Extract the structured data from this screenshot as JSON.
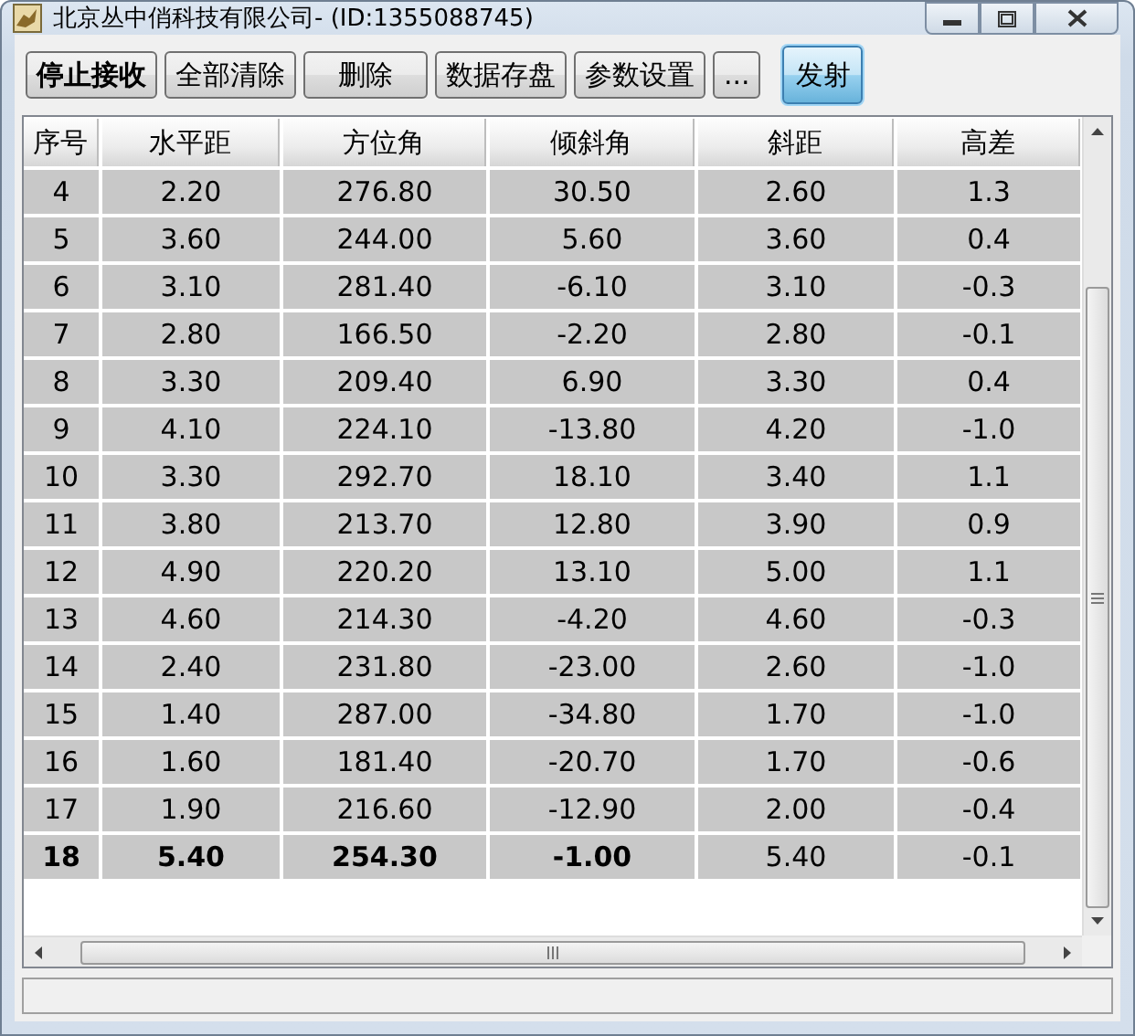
{
  "window": {
    "title": "北京丛中俏科技有限公司- (ID:1355088745)"
  },
  "toolbar": [
    {
      "label": "停止接收",
      "bold": true,
      "selected": false
    },
    {
      "label": "全部清除",
      "bold": false,
      "selected": false
    },
    {
      "label": "删除",
      "bold": false,
      "selected": false
    },
    {
      "label": "数据存盘",
      "bold": false,
      "selected": false
    },
    {
      "label": "参数设置",
      "bold": false,
      "selected": false
    },
    {
      "label": "...",
      "bold": false,
      "selected": false
    },
    {
      "label": "发射",
      "bold": false,
      "selected": true
    }
  ],
  "table": {
    "columns": [
      "序号",
      "水平距",
      "方位角",
      "倾斜角",
      "斜距",
      "高差"
    ],
    "rows": [
      {
        "cells": [
          {
            "text": "4",
            "bold": false
          },
          {
            "text": "2.20",
            "bold": false
          },
          {
            "text": "276.80",
            "bold": false
          },
          {
            "text": "30.50",
            "bold": false
          },
          {
            "text": "2.60",
            "bold": false
          },
          {
            "text": "1.3",
            "bold": false
          }
        ]
      },
      {
        "cells": [
          {
            "text": "5",
            "bold": false
          },
          {
            "text": "3.60",
            "bold": false
          },
          {
            "text": "244.00",
            "bold": false
          },
          {
            "text": "5.60",
            "bold": false
          },
          {
            "text": "3.60",
            "bold": false
          },
          {
            "text": "0.4",
            "bold": false
          }
        ]
      },
      {
        "cells": [
          {
            "text": "6",
            "bold": false
          },
          {
            "text": "3.10",
            "bold": false
          },
          {
            "text": "281.40",
            "bold": false
          },
          {
            "text": "-6.10",
            "bold": false
          },
          {
            "text": "3.10",
            "bold": false
          },
          {
            "text": "-0.3",
            "bold": false
          }
        ]
      },
      {
        "cells": [
          {
            "text": "7",
            "bold": false
          },
          {
            "text": "2.80",
            "bold": false
          },
          {
            "text": "166.50",
            "bold": false
          },
          {
            "text": "-2.20",
            "bold": false
          },
          {
            "text": "2.80",
            "bold": false
          },
          {
            "text": "-0.1",
            "bold": false
          }
        ]
      },
      {
        "cells": [
          {
            "text": "8",
            "bold": false
          },
          {
            "text": "3.30",
            "bold": false
          },
          {
            "text": "209.40",
            "bold": false
          },
          {
            "text": "6.90",
            "bold": false
          },
          {
            "text": "3.30",
            "bold": false
          },
          {
            "text": "0.4",
            "bold": false
          }
        ]
      },
      {
        "cells": [
          {
            "text": "9",
            "bold": false
          },
          {
            "text": "4.10",
            "bold": false
          },
          {
            "text": "224.10",
            "bold": false
          },
          {
            "text": "-13.80",
            "bold": false
          },
          {
            "text": "4.20",
            "bold": false
          },
          {
            "text": "-1.0",
            "bold": false
          }
        ]
      },
      {
        "cells": [
          {
            "text": "10",
            "bold": false
          },
          {
            "text": "3.30",
            "bold": false
          },
          {
            "text": "292.70",
            "bold": false
          },
          {
            "text": "18.10",
            "bold": false
          },
          {
            "text": "3.40",
            "bold": false
          },
          {
            "text": "1.1",
            "bold": false
          }
        ]
      },
      {
        "cells": [
          {
            "text": "11",
            "bold": false
          },
          {
            "text": "3.80",
            "bold": false
          },
          {
            "text": "213.70",
            "bold": false
          },
          {
            "text": "12.80",
            "bold": false
          },
          {
            "text": "3.90",
            "bold": false
          },
          {
            "text": "0.9",
            "bold": false
          }
        ]
      },
      {
        "cells": [
          {
            "text": "12",
            "bold": false
          },
          {
            "text": "4.90",
            "bold": false
          },
          {
            "text": "220.20",
            "bold": false
          },
          {
            "text": "13.10",
            "bold": false
          },
          {
            "text": "5.00",
            "bold": false
          },
          {
            "text": "1.1",
            "bold": false
          }
        ]
      },
      {
        "cells": [
          {
            "text": "13",
            "bold": false
          },
          {
            "text": "4.60",
            "bold": false
          },
          {
            "text": "214.30",
            "bold": false
          },
          {
            "text": "-4.20",
            "bold": false
          },
          {
            "text": "4.60",
            "bold": false
          },
          {
            "text": "-0.3",
            "bold": false
          }
        ]
      },
      {
        "cells": [
          {
            "text": "14",
            "bold": false
          },
          {
            "text": "2.40",
            "bold": false
          },
          {
            "text": "231.80",
            "bold": false
          },
          {
            "text": "-23.00",
            "bold": false
          },
          {
            "text": "2.60",
            "bold": false
          },
          {
            "text": "-1.0",
            "bold": false
          }
        ]
      },
      {
        "cells": [
          {
            "text": "15",
            "bold": false
          },
          {
            "text": "1.40",
            "bold": false
          },
          {
            "text": "287.00",
            "bold": false
          },
          {
            "text": "-34.80",
            "bold": false
          },
          {
            "text": "1.70",
            "bold": false
          },
          {
            "text": "-1.0",
            "bold": false
          }
        ]
      },
      {
        "cells": [
          {
            "text": "16",
            "bold": false
          },
          {
            "text": "1.60",
            "bold": false
          },
          {
            "text": "181.40",
            "bold": false
          },
          {
            "text": "-20.70",
            "bold": false
          },
          {
            "text": "1.70",
            "bold": false
          },
          {
            "text": "-0.6",
            "bold": false
          }
        ]
      },
      {
        "cells": [
          {
            "text": "17",
            "bold": false
          },
          {
            "text": "1.90",
            "bold": false
          },
          {
            "text": "216.60",
            "bold": false
          },
          {
            "text": "-12.90",
            "bold": false
          },
          {
            "text": "2.00",
            "bold": false
          },
          {
            "text": "-0.4",
            "bold": false
          }
        ]
      },
      {
        "cells": [
          {
            "text": "18",
            "bold": true
          },
          {
            "text": "5.40",
            "bold": true
          },
          {
            "text": "254.30",
            "bold": true
          },
          {
            "text": "-1.00",
            "bold": true
          },
          {
            "text": "5.40",
            "bold": false
          },
          {
            "text": "-0.1",
            "bold": false
          }
        ]
      }
    ]
  }
}
